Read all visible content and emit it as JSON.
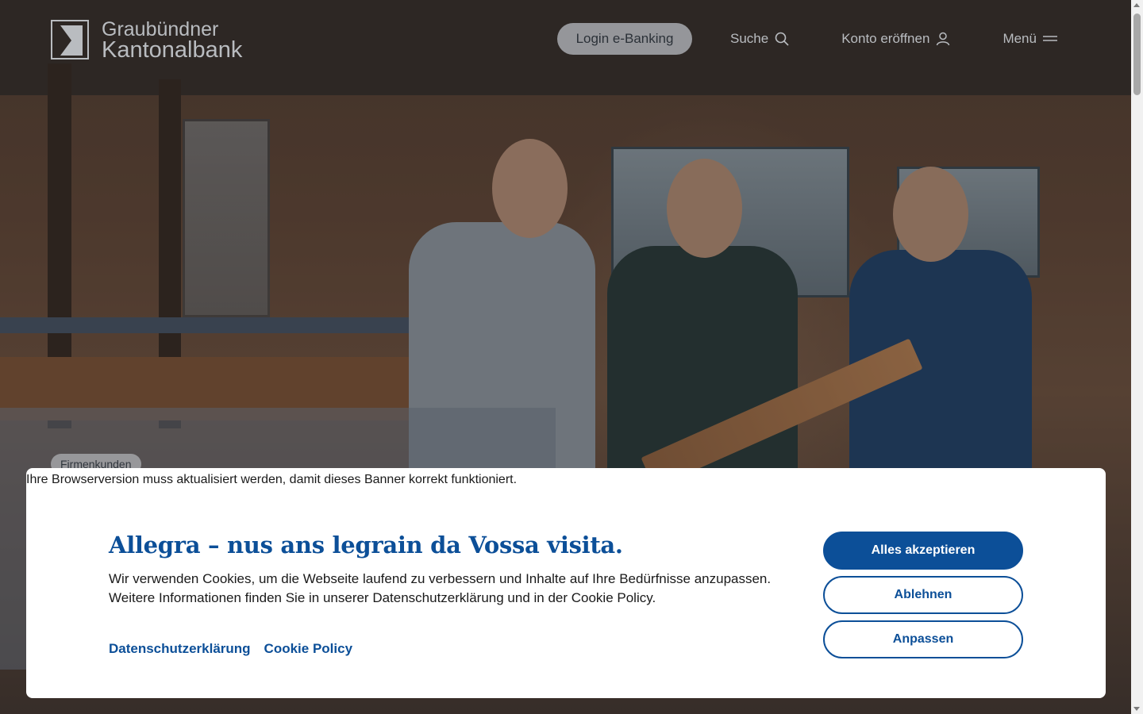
{
  "header": {
    "logo": {
      "line1": "Graubündner",
      "line2": "Kantonalbank"
    },
    "login_label": "Login e-Banking",
    "search_label": "Suche",
    "search_icon": "search-icon",
    "konto_label": "Konto eröffnen",
    "konto_icon": "user-icon",
    "menu_label": "Menü",
    "menu_icon": "hamburger-icon"
  },
  "hero": {
    "tag": "Firmenkunden"
  },
  "cookie_banner": {
    "browser_note": "Ihre Browserversion muss aktualisiert werden, damit dieses Banner korrekt funktioniert.",
    "title": "Allegra – nus ans legrain da Vossa visita.",
    "text_line1": "Wir verwenden Cookies, um die Webseite laufend zu verbessern und Inhalte auf Ihre Bedürfnisse anzupassen.",
    "text_line2": "Weitere Informationen finden Sie in unserer Datenschutzerklärung und in der Cookie Policy.",
    "link_privacy": "Datenschutzerklärung",
    "link_cookie": "Cookie Policy",
    "accept_label": "Alles akzeptieren",
    "reject_label": "Ablehnen",
    "customize_label": "Anpassen"
  },
  "colors": {
    "brand_blue": "#0c4f98",
    "header_text": "#b9bcc0"
  }
}
